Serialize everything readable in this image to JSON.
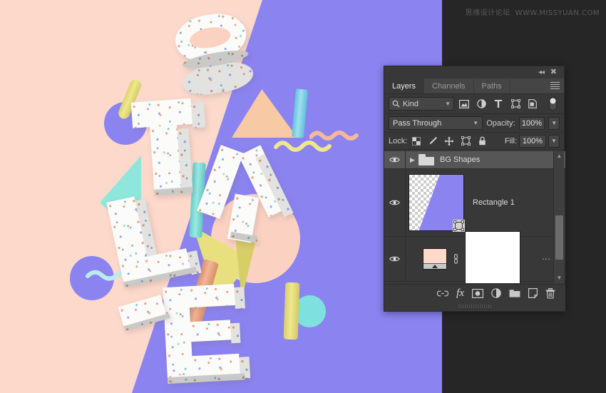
{
  "app": {
    "watermark_cn": "思缘设计论坛",
    "watermark_url": "WWW.MISSYUAN.COM",
    "canvas_bg_peach": "#fcd9cb",
    "canvas_bg_purple": "#8b83f0"
  },
  "panel": {
    "titlebar": {
      "collapse_icon": "collapse-double-arrow-icon",
      "close_icon": "close-icon",
      "menu_icon": "panel-menu-icon"
    },
    "tabs": [
      {
        "label": "Layers",
        "active": true
      },
      {
        "label": "Channels",
        "active": false
      },
      {
        "label": "Paths",
        "active": false
      }
    ],
    "filter_row": {
      "search_icon": "search-icon",
      "kind_label": "Kind",
      "caret": "chevron-down-icon",
      "filter_icons": [
        "pixel-layer-filter-icon",
        "adjustment-layer-filter-icon",
        "type-layer-filter-icon",
        "shape-layer-filter-icon",
        "smart-object-filter-icon"
      ],
      "toggle_icon": "filter-toggle-switch-icon"
    },
    "blend_row": {
      "blend_mode": "Pass Through",
      "caret": "chevron-down-icon",
      "opacity_label": "Opacity:",
      "opacity_value": "100%"
    },
    "lock_row": {
      "lock_label": "Lock:",
      "lock_icons": [
        "lock-transparent-pixels-icon",
        "lock-image-pixels-icon",
        "lock-position-icon",
        "lock-artboard-nesting-icon",
        "lock-all-icon"
      ],
      "fill_label": "Fill:",
      "fill_value": "100%"
    },
    "layers": [
      {
        "name": "BG Shapes",
        "type": "group",
        "visible": true,
        "selected": true,
        "expanded": false,
        "disclosure": "chevron-right-icon",
        "thumb": "folder-icon"
      },
      {
        "name": "Rectangle 1",
        "type": "shape",
        "visible": true,
        "selected": false,
        "thumb": "shape-thumbnail-purple-wedge",
        "badge": "vector-mask-badge-icon"
      },
      {
        "name": "",
        "type": "image",
        "visible": true,
        "selected": false,
        "thumb": "peach-gradient-thumbnail",
        "link_icon": "link-mask-icon",
        "mask_thumb": "white-layer-mask",
        "overflow_icon": "more-options-icon"
      }
    ],
    "bottom_bar_icons": [
      "link-layers-icon",
      "add-layer-style-fx-icon",
      "add-layer-mask-icon",
      "new-adjustment-layer-icon",
      "new-group-icon",
      "new-layer-icon",
      "delete-layer-icon"
    ],
    "scrollbar": {
      "up_arrow": "scroll-up-arrow-icon",
      "down_arrow": "scroll-down-arrow-icon"
    }
  },
  "artwork": {
    "description": "3D Memphis-style lettering STYLE composed of speckled terrazzo blocks with pastel geometric props",
    "letters": [
      "S",
      "T",
      "Y",
      "L",
      "E"
    ],
    "palette": {
      "peach": "#fcd9cb",
      "purple": "#8b83f0",
      "yellow": "#ece07a",
      "mint": "#8fe6dd",
      "sky": "#8ad8e8",
      "salmon": "#f0b393",
      "terrazzo": "#fbfbf9"
    }
  }
}
